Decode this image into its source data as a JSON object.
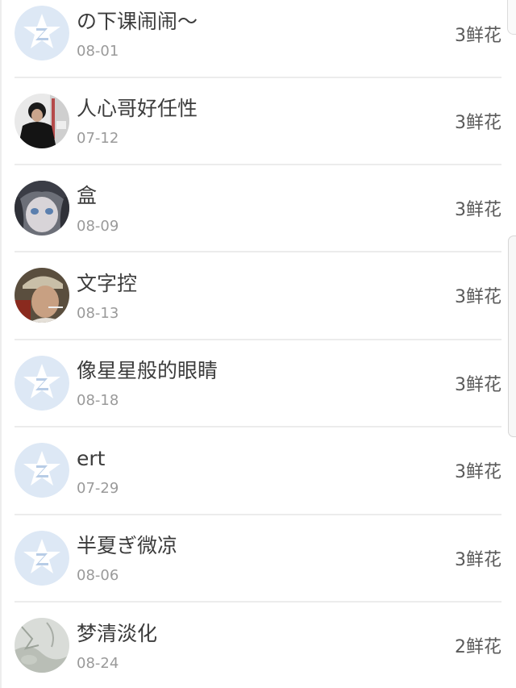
{
  "list": {
    "items": [
      {
        "name": "の下课闹闹〜",
        "date": "08-01",
        "gift": "3鲜花",
        "avatar": "default-qzone-icon"
      },
      {
        "name": "人心哥好任性",
        "date": "07-12",
        "gift": "3鲜花",
        "avatar": "photo-man-dark"
      },
      {
        "name": "盒",
        "date": "08-09",
        "gift": "3鲜花",
        "avatar": "photo-anime-girl"
      },
      {
        "name": "文字控",
        "date": "08-13",
        "gift": "3鲜花",
        "avatar": "photo-man-hat"
      },
      {
        "name": "像星星般的眼睛",
        "date": "08-18",
        "gift": "3鲜花",
        "avatar": "default-qzone-icon"
      },
      {
        "name": "ert",
        "date": "07-29",
        "gift": "3鲜花",
        "avatar": "default-qzone-icon"
      },
      {
        "name": "半夏ぎ微凉",
        "date": "08-06",
        "gift": "3鲜花",
        "avatar": "default-qzone-icon"
      },
      {
        "name": "梦清淡化",
        "date": "08-24",
        "gift": "2鲜花",
        "avatar": "photo-grey-sketch"
      }
    ]
  },
  "colors": {
    "default_avatar_bg": "#dde8f5",
    "default_avatar_star": "#ffffff",
    "default_avatar_z": "#b7cce6",
    "text_primary": "#3c3c3c",
    "text_secondary": "#9a9a9a",
    "divider": "#ececec"
  }
}
